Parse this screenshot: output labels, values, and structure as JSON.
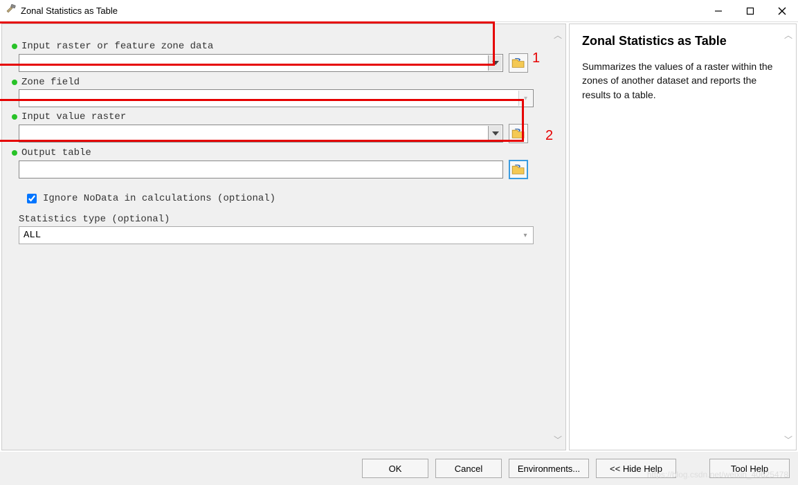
{
  "window": {
    "title": "Zonal Statistics as Table"
  },
  "fields": {
    "zone_data": {
      "label": "Input raster or feature zone data",
      "value": ""
    },
    "zone_field": {
      "label": "Zone field",
      "value": ""
    },
    "value_raster": {
      "label": "Input value raster",
      "value": ""
    },
    "output_table": {
      "label": "Output table",
      "value": ""
    },
    "ignore_nodata": {
      "label": "Ignore NoData in calculations (optional)",
      "checked": true
    },
    "stat_type": {
      "label": "Statistics type (optional)",
      "value": "ALL"
    }
  },
  "annotations": {
    "box1_label": "1",
    "box2_label": "2"
  },
  "buttons": {
    "ok": "OK",
    "cancel": "Cancel",
    "env": "Environments...",
    "hide_help": "<< Hide Help",
    "tool_help": "Tool Help"
  },
  "help": {
    "title": "Zonal Statistics as Table",
    "body": "Summarizes the values of a raster within the zones of another dataset and reports the results to a table."
  },
  "watermark": "https://blog.csdn.net/weixin_40625478"
}
